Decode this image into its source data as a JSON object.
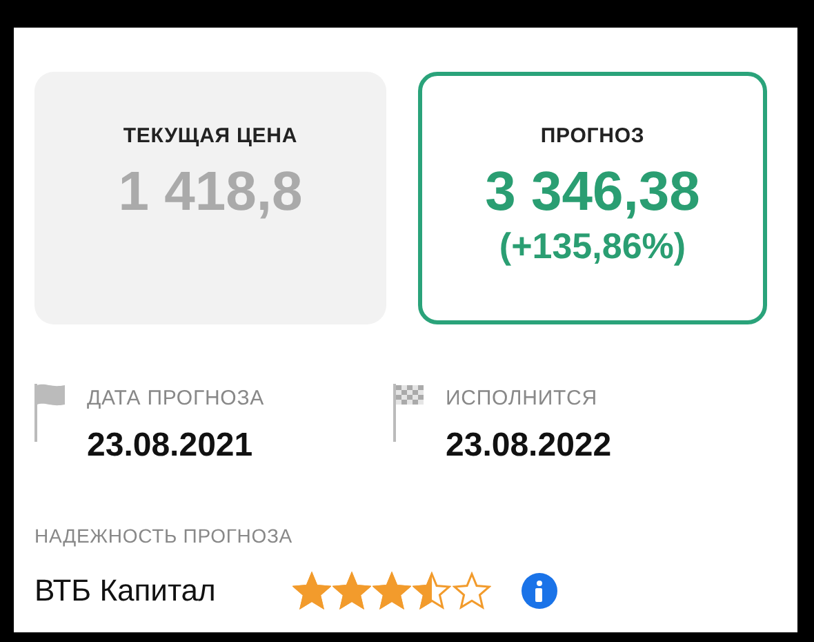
{
  "current_price": {
    "label": "ТЕКУЩАЯ ЦЕНА",
    "value": "1 418,8"
  },
  "forecast": {
    "label": "ПРОГНОЗ",
    "value": "3 346,38",
    "change": "(+135,86%)"
  },
  "dates": [
    {
      "kind": "start",
      "label": "ДАТА ПРОГНОЗА",
      "date": "23.08.2021"
    },
    {
      "kind": "finish",
      "label": "ИСПОЛНИТСЯ",
      "date": "23.08.2022"
    }
  ],
  "reliability": {
    "label": "НАДЕЖНОСТЬ ПРОГНОЗА",
    "source": "ВТБ Капитал",
    "stars": 3.5
  }
}
